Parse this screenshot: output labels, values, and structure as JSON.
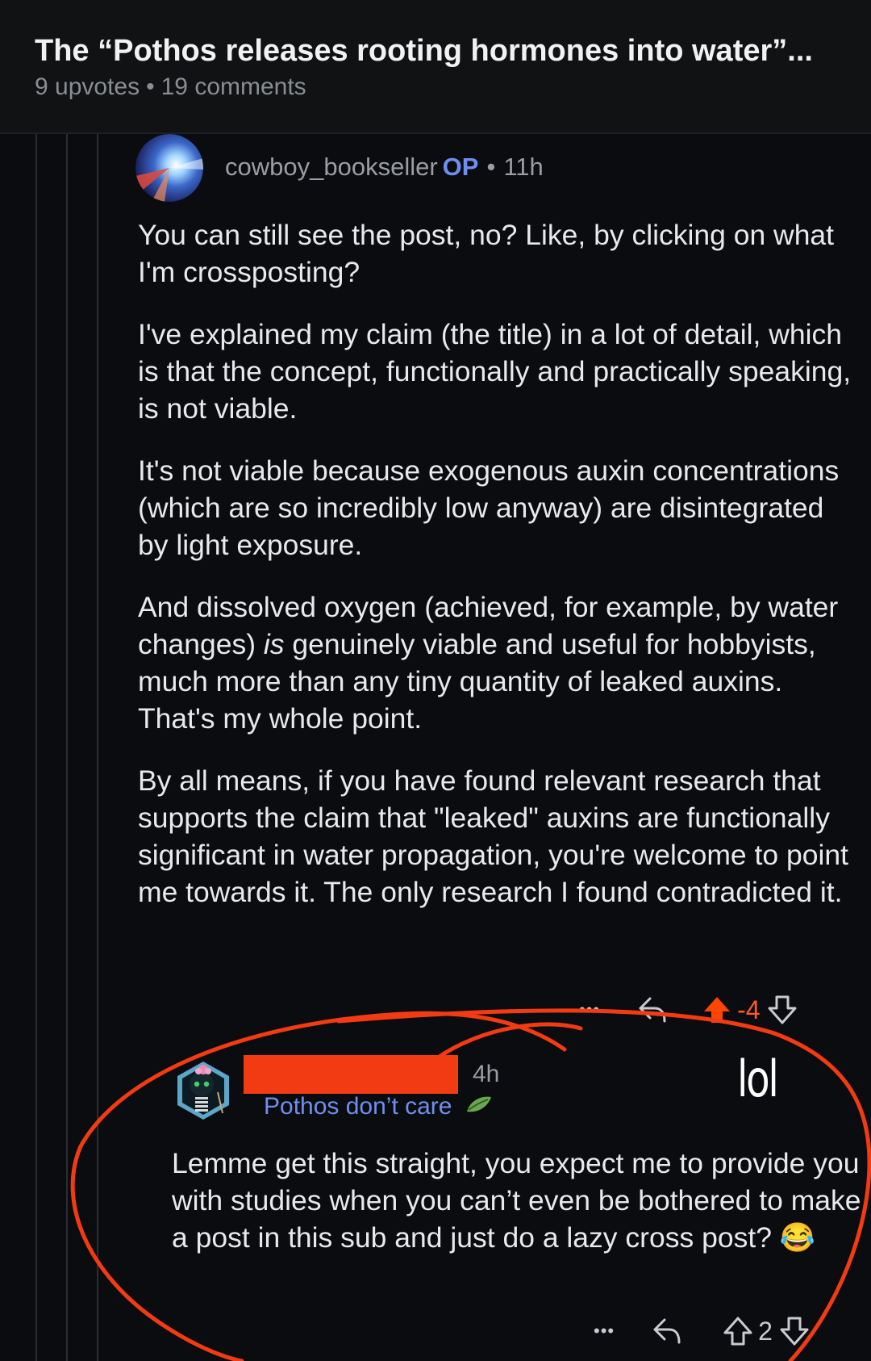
{
  "header": {
    "title": "The “Pothos releases rooting hormones into water”...",
    "upvotes": "9 upvotes",
    "comments": "19 comments"
  },
  "op_comment": {
    "username": "cowboy_bookseller",
    "op_tag": "OP",
    "time": "11h",
    "paragraphs": [
      "You can still see the post, no? Like, by clicking on what I'm crossposting?",
      "I've explained my claim (the title) in a lot of detail, which is that the concept, functionally and practically speaking, is not viable.",
      "It's not viable because exogenous auxin concentrations (which are so incredibly low anyway) are disintegrated by light exposure.",
      "By all means, if you have found relevant research that supports the claim that \"leaked\" auxins are functionally significant in water propagation, you're welcome to point me towards it. The only research I found contradicted it."
    ],
    "para4_before": "And dissolved oxygen (achieved, for example, by water changes) ",
    "para4_italic": "is",
    "para4_after": " genuinely viable and useful for hobbyists, much more than any tiny quantity of leaked auxins. That's my whole point.",
    "more": "•••",
    "score": "-4",
    "upvote_color": "#ff4500"
  },
  "reply_comment": {
    "time": "4h",
    "flair": "Pothos don’t care",
    "body": "Lemme get this straight, you expect me to provide you with studies when you can’t even be bothered to make a post in this sub and just do a lazy cross post? 😂",
    "more": "•••",
    "score": "2"
  },
  "annotation": {
    "text": "lol",
    "color": "#f23b12"
  }
}
